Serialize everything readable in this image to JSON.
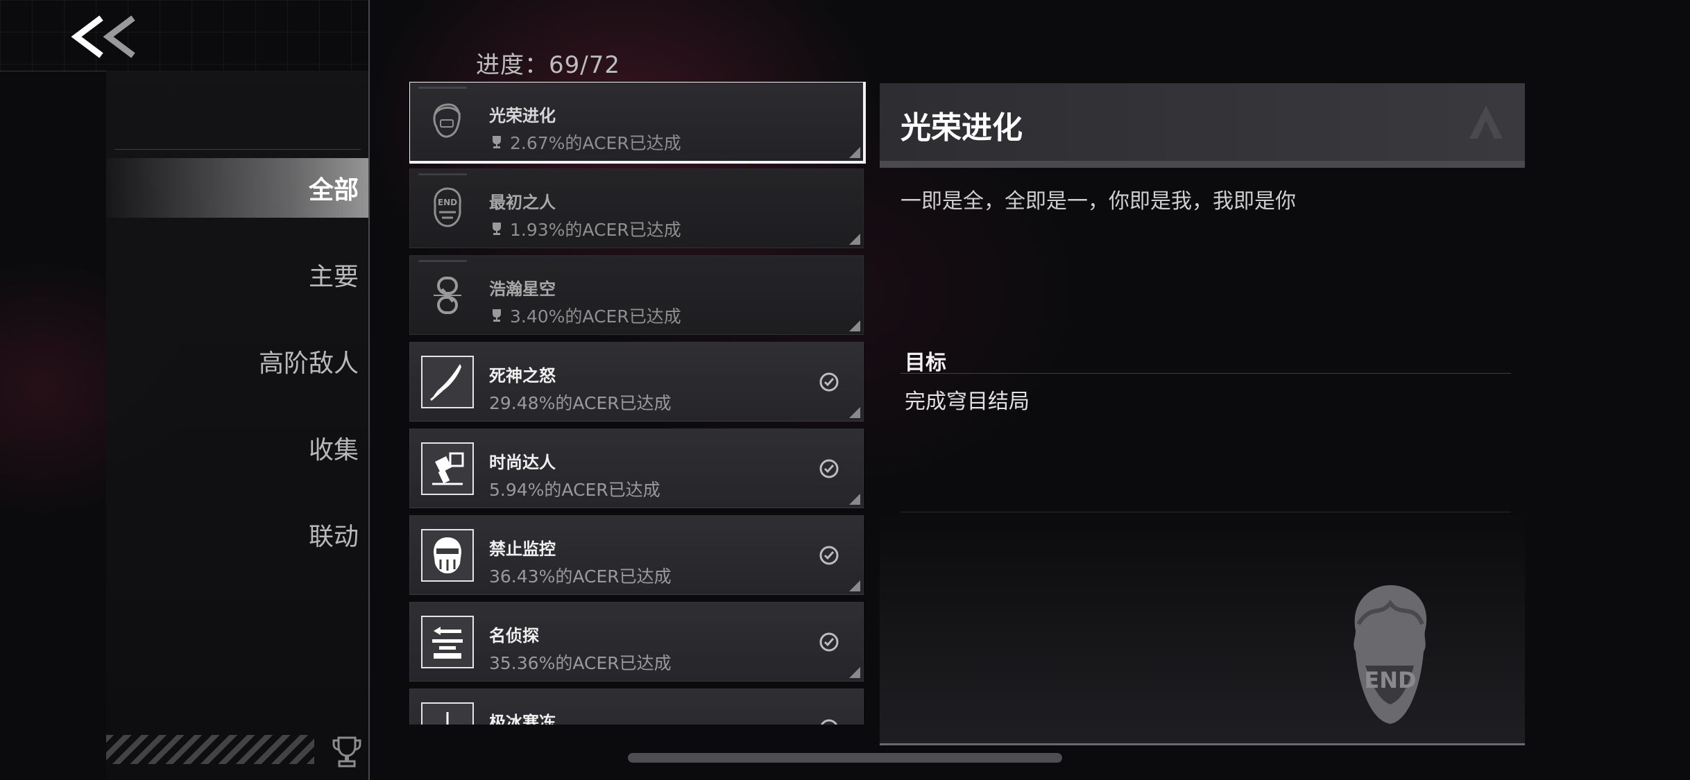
{
  "nav": {
    "back_icon": "double-chevron-left-icon",
    "items": [
      {
        "label": "全部",
        "active": true
      },
      {
        "label": "主要",
        "active": false
      },
      {
        "label": "高阶敌人",
        "active": false
      },
      {
        "label": "收集",
        "active": false
      },
      {
        "label": "联动",
        "active": false
      }
    ],
    "footer_icon": "trophy-icon"
  },
  "progress": {
    "text": "进度：69/72",
    "done": 69,
    "total": 72
  },
  "achievements": [
    {
      "title": "光荣进化",
      "rate": "2.67%的ACER已达成",
      "state": "locked",
      "selected": true,
      "icon": "head-profile-icon"
    },
    {
      "title": "最初之人",
      "rate": "1.93%的ACER已达成",
      "state": "locked",
      "selected": false,
      "icon": "end-head-icon"
    },
    {
      "title": "浩瀚星空",
      "rate": "3.40%的ACER已达成",
      "state": "locked",
      "selected": false,
      "icon": "chain-link-icon"
    },
    {
      "title": "死神之怒",
      "rate": "29.48%的ACER已达成",
      "state": "unlocked",
      "selected": false,
      "icon": "scythe-blade-icon"
    },
    {
      "title": "时尚达人",
      "rate": "5.94%的ACER已达成",
      "state": "unlocked",
      "selected": false,
      "icon": "paint-tools-icon"
    },
    {
      "title": "禁止监控",
      "rate": "36.43%的ACER已达成",
      "state": "unlocked",
      "selected": false,
      "icon": "masked-face-icon"
    },
    {
      "title": "名侦探",
      "rate": "35.36%的ACER已达成",
      "state": "unlocked",
      "selected": false,
      "icon": "detective-icon"
    },
    {
      "title": "极冰寒冻",
      "rate": "",
      "state": "unlocked",
      "selected": false,
      "icon": "ice-icon"
    }
  ],
  "detail": {
    "title": "光荣进化",
    "description": "一即是全，全即是一，你即是我，我即是你",
    "goal_label": "目标",
    "goal_text": "完成穹目结局",
    "emblem_text": "END",
    "logo_icon": "triangle-logo-icon"
  },
  "colors": {
    "background": "#0b0b0d",
    "card": "#2f2f33",
    "selected_outline": "#f2f2f2",
    "accent_glow": "#6e1e37"
  }
}
